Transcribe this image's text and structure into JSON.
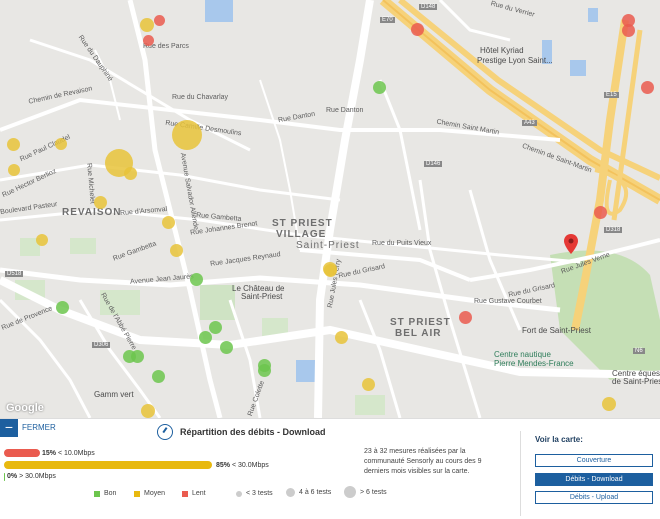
{
  "map": {
    "labels": {
      "revaison": "REVAISON",
      "st_priest_village_1": "ST PRIEST",
      "st_priest_village_2": "VILLAGE",
      "st_priest_city": "Saint-Priest",
      "st_priest_bel_air_1": "ST PRIEST",
      "st_priest_bel_air_2": "BEL AIR",
      "chateau_1": "Le Château de",
      "chateau_2": "Saint-Priest",
      "fort": "Fort de Saint-Priest",
      "centre_nautique_1": "Centre nautique",
      "centre_nautique_2": "Pierre Mendes-France",
      "centre_equestre_1": "Centre équestre",
      "centre_equestre_2": "de Saint-Priest",
      "gamm_vert": "Gamm vert",
      "hotel_1": "Hôtel Kyriad",
      "hotel_2": "Prestige Lyon Saint...",
      "rue_dauphine": "Rue du Dauphiné",
      "chemin_revaison": "Chemin de Revaison",
      "rue_paul_claudel": "Rue Paul Claudel",
      "rue_hector_berlioz": "Rue Hector Berlioz",
      "boulevard_pasteur": "Boulevard Pasteur",
      "rue_michelet": "Rue Michelet",
      "rue_arsonval": "Rue d'Arsonval",
      "rue_gambetta": "Rue Gambetta",
      "rue_gambetta_2": "Rue Gambetta",
      "rue_johannes_brenot": "Rue Johannes Brenot",
      "rue_jacques_reynaud": "Rue Jacques Reynaud",
      "rue_danton": "Rue Danton",
      "rue_danton_2": "Rue Danton",
      "rue_chavarlay": "Rue du Chavarlay",
      "rue_camille_desmoulins": "Rue Camille Desmoulins",
      "rue_du_puits_vieux": "Rue du Puits Vieux",
      "rue_du_grisard": "Rue du Grisard",
      "rue_du_grisard_2": "Rue du Grisard",
      "rue_gustave_courbet": "Rue Gustave Courbet",
      "rue_jules_verne": "Rue Jules Verne",
      "chemin_saint_martin": "Chemin Saint Martin",
      "chemin_de_saint_martin": "Chemin de Saint-Martin",
      "rue_jules_ferry": "Rue Jules Ferry",
      "rue_provence": "Rue de Provence",
      "rue_abbe_pierre": "Rue de l'Abbé Pierre",
      "avenue_jean_jaures": "Avenue Jean Jaurès",
      "rue_des_parcs": "Rue des Parcs",
      "rue_du_verrier": "Rue du Verrier",
      "rue_colette": "Rue Colette",
      "e70": "E70",
      "e15": "E15",
      "d318": "D318",
      "d148": "D148",
      "a43": "A43",
      "d518": "D518",
      "n6": "N6",
      "d146": "D146",
      "d306": "D306",
      "avenue_salvador_allende": "Avenue Salvador Allende"
    },
    "google": "Google",
    "markers": [
      {
        "color": "yellow",
        "size": 14
      },
      {
        "color": "red",
        "size": 11
      },
      {
        "color": "red",
        "size": 11
      },
      {
        "color": "red",
        "size": 13
      },
      {
        "color": "red",
        "size": 13
      },
      {
        "color": "red",
        "size": 13
      },
      {
        "color": "green",
        "size": 13
      },
      {
        "color": "red",
        "size": 13
      },
      {
        "color": "yellow",
        "size": 13
      },
      {
        "color": "yellow",
        "size": 28
      },
      {
        "color": "yellow",
        "size": 30
      },
      {
        "color": "yellow",
        "size": 13
      },
      {
        "color": "yellow",
        "size": 12
      },
      {
        "color": "yellow",
        "size": 13
      },
      {
        "color": "yellow",
        "size": 12
      },
      {
        "color": "yellow",
        "size": 13
      },
      {
        "color": "yellow",
        "size": 13
      },
      {
        "color": "yellow",
        "size": 14
      },
      {
        "color": "red",
        "size": 13
      },
      {
        "color": "red",
        "size": 13
      },
      {
        "color": "green",
        "size": 13
      },
      {
        "color": "green",
        "size": 13
      },
      {
        "color": "green",
        "size": 13
      },
      {
        "color": "green",
        "size": 13
      },
      {
        "color": "green",
        "size": 13
      },
      {
        "color": "green",
        "size": 13
      },
      {
        "color": "green",
        "size": 13
      },
      {
        "color": "green",
        "size": 13
      },
      {
        "color": "green",
        "size": 13
      },
      {
        "color": "yellow",
        "size": 13
      },
      {
        "color": "yellow",
        "size": 13
      },
      {
        "color": "yellow",
        "size": 14
      },
      {
        "color": "yellow",
        "size": 14
      },
      {
        "color": "green",
        "size": 13
      },
      {
        "color": "yellow",
        "size": 12
      },
      {
        "color": "yellow",
        "size": 13
      }
    ]
  },
  "panel": {
    "close_icon": "−",
    "close_label": "FERMER",
    "title": "Répartition des débits - Download",
    "bars": [
      {
        "pct_label": "15%",
        "range": "< 10.0Mbps",
        "value": 15,
        "color": "#ea5b4f"
      },
      {
        "pct_label": "85%",
        "range": "< 30.0Mbps",
        "value": 85,
        "color": "#e8b90f"
      },
      {
        "pct_label": "0%",
        "range": "> 30.0Mbps",
        "value": 0,
        "color": "#6cc54d"
      }
    ],
    "description": "23 à 32 mesures réalisées par la communauté Sensorly au cours des 9 derniers mois visibles sur la carte.",
    "legend": {
      "bon": "Bon",
      "moyen": "Moyen",
      "lent": "Lent",
      "lt3": "< 3 tests",
      "4to6": "4 à 6 tests",
      "gt6": "> 6 tests"
    },
    "colors": {
      "green": "#6cc54d",
      "yellow": "#e8b90f",
      "red": "#ea5b4f",
      "accent": "#1d5f9f"
    },
    "sidebar": {
      "title": "Voir la carte:",
      "couverture": "Couverture",
      "download": "Débits - Download",
      "upload": "Débits - Upload"
    }
  }
}
